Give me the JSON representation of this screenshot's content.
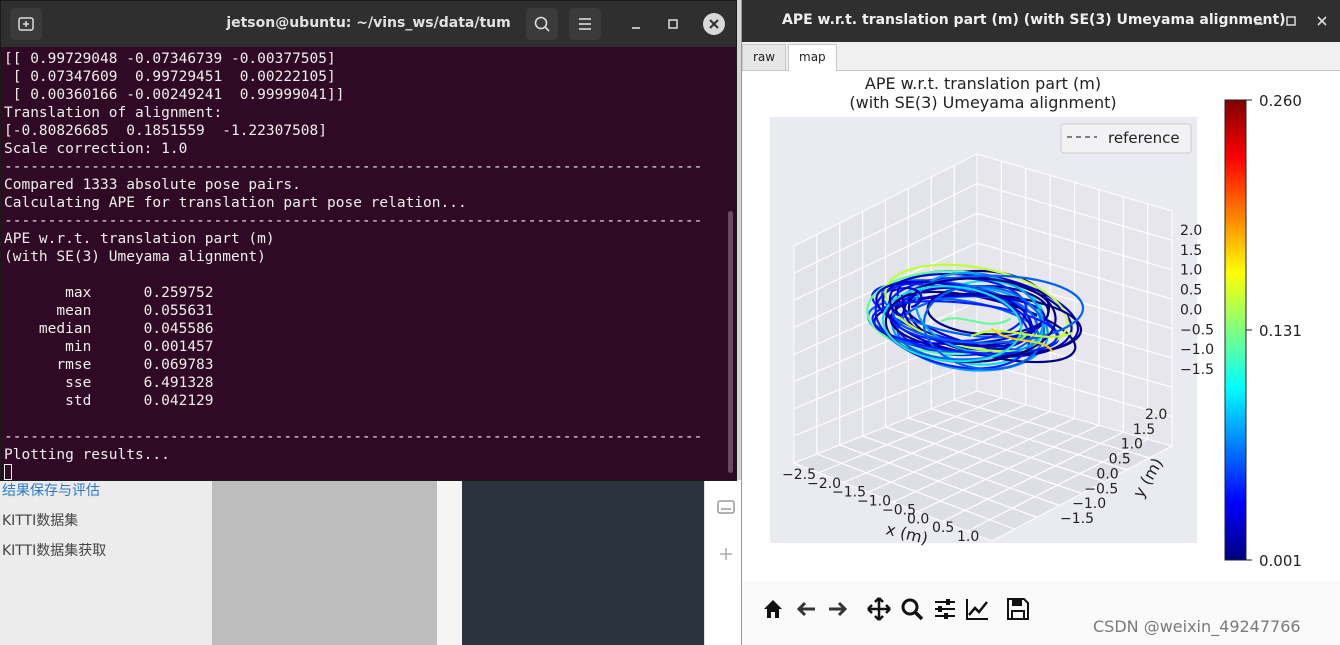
{
  "background": {
    "links": [
      "结果保存与评估",
      "KITTI数据集",
      "KITTI数据集获取"
    ],
    "icons": [
      "keyboard-icon",
      "plus-icon"
    ]
  },
  "terminal": {
    "title": "jetson@ubuntu: ~/vins_ws/data/tum",
    "icons": {
      "new_tab": "▣",
      "search": "⌕",
      "menu": "☰",
      "minimize": "_",
      "maximize": "□",
      "close": "✕"
    },
    "lines": [
      "[[ 0.99729048 -0.07346739 -0.00377505]",
      " [ 0.07347609  0.99729451  0.00222105]",
      " [ 0.00360166 -0.00249241  0.99999041]]",
      "Translation of alignment:",
      "[-0.80826685  0.1851559  -1.22307508]",
      "Scale correction: 1.0",
      "--------------------------------------------------------------------------------",
      "Compared 1333 absolute pose pairs.",
      "Calculating APE for translation part pose relation...",
      "--------------------------------------------------------------------------------",
      "APE w.r.t. translation part (m)",
      "(with SE(3) Umeyama alignment)",
      "",
      "       max      0.259752",
      "      mean      0.055631",
      "    median      0.045586",
      "       min      0.001457",
      "      rmse      0.069783",
      "       sse      6.491328",
      "       std      0.042129",
      "",
      "--------------------------------------------------------------------------------",
      "Plotting results..."
    ]
  },
  "plot_window": {
    "title": "APE w.r.t. translation part (m) (with SE(3) Umeyama alignment)",
    "tabs": [
      "raw",
      "map"
    ],
    "active_tab": "map",
    "toolbar": [
      "home-icon",
      "back-icon",
      "forward-icon",
      "pan-icon",
      "zoom-icon",
      "configure-icon",
      "edit-axis-icon",
      "save-icon"
    ]
  },
  "chart_data": {
    "type": "line",
    "title": "APE w.r.t. translation part (m)",
    "subtitle": "(with SE(3) Umeyama alignment)",
    "xlabel": "x (m)",
    "ylabel": "y (m)",
    "legend": [
      {
        "name": "reference",
        "style": "dashed",
        "color": "#7f7f7f"
      }
    ],
    "legend_position": "top-right",
    "x_ticks": [
      "−2.5",
      "−2.0",
      "−1.5",
      "−1.0",
      "−0.5",
      "0.0",
      "0.5",
      "1.0"
    ],
    "y_ticks": [
      "−1.5",
      "−1.0",
      "−0.5",
      "0.0",
      "0.5",
      "1.0",
      "1.5",
      "2.0"
    ],
    "z_ticks": [
      "2.0",
      "1.5",
      "1.0",
      "0.5",
      "0.0",
      "−0.5",
      "−1.0",
      "−1.5"
    ],
    "colorbar": {
      "min": "0.001",
      "mid": "0.131",
      "max": "0.260",
      "colormap": "jet"
    },
    "grid": true
  },
  "watermark": "CSDN @weixin_49247766"
}
